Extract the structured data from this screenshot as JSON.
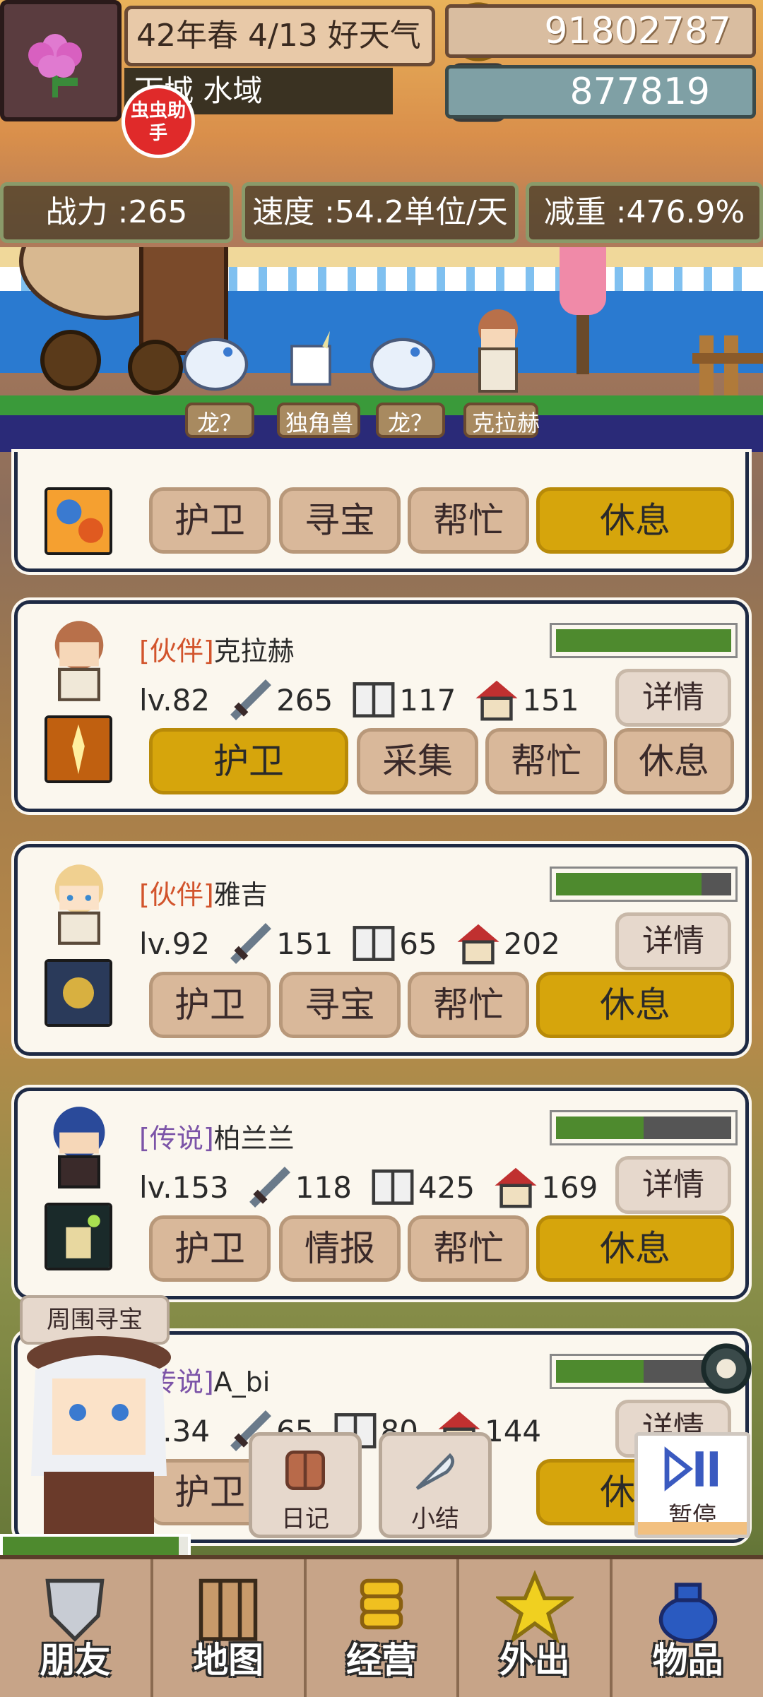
{
  "hud": {
    "date": "42年春 4/13 好天气",
    "location": "下城 水域",
    "helper": "虫虫助手",
    "gold": "91802787",
    "silver": "877819"
  },
  "stats": {
    "power": "战力 :265",
    "speed": "速度 :54.2单位/天",
    "weight": "减重 :476.9%"
  },
  "party_labels": [
    "龙？",
    "独角兽",
    "龙？",
    "克拉赫"
  ],
  "top_card": {
    "buttons": [
      "护卫",
      "寻宝",
      "帮忙",
      "休息"
    ],
    "active": "休息"
  },
  "companions": [
    {
      "rank": "[伙伴]",
      "name": "克拉赫",
      "level": "lv.82",
      "attack": "265",
      "wisdom": "117",
      "home": "151",
      "hp_fill": 1.0,
      "detail": "详情",
      "buttons": [
        "护卫",
        "采集",
        "帮忙",
        "休息"
      ],
      "active_index": 0
    },
    {
      "rank": "[伙伴]",
      "name": "雅吉",
      "level": "lv.92",
      "attack": "151",
      "wisdom": "65",
      "home": "202",
      "hp_fill": 0.83,
      "detail": "详情",
      "buttons": [
        "护卫",
        "寻宝",
        "帮忙",
        "休息"
      ],
      "active_index": 3
    },
    {
      "rank": "[传说]",
      "name": "柏兰兰",
      "level": "lv.153",
      "attack": "118",
      "wisdom": "425",
      "home": "169",
      "hp_fill": 0.5,
      "detail": "详情",
      "buttons": [
        "护卫",
        "情报",
        "帮忙",
        "休息"
      ],
      "active_index": 3
    },
    {
      "rank": "[传说]",
      "name": "A_bi",
      "level": "lv.34",
      "attack": "65",
      "wisdom": "80",
      "home": "144",
      "hp_fill": 0.5,
      "detail": "详情",
      "buttons": [
        "护卫",
        "",
        "",
        "休息"
      ],
      "active_index": 3
    }
  ],
  "overlay": {
    "round_treasure": "周围寻宝",
    "diary": "日记",
    "summary": "小结",
    "pause": "暂停",
    "xp_fill": 0.95
  },
  "nav": [
    "朋友",
    "地图",
    "经营",
    "外出",
    "物品"
  ],
  "colors": {
    "active_button": "#d6a50c",
    "hp_green": "#4e8a2e",
    "rank_companion": "#d2542c",
    "rank_legend": "#7c54a8"
  }
}
